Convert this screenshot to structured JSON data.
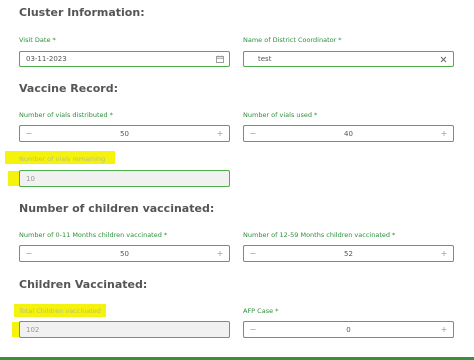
{
  "sections": {
    "cluster_info": "Cluster Information:",
    "vaccine_record": "Vaccine Record:",
    "children_vaccinated_count": "Number of children vaccinated:",
    "children_vaccinated": "Children Vaccinated:"
  },
  "fields": {
    "visit_date": {
      "label": "Visit Date",
      "value": "03-11-2023"
    },
    "district_coordinator": {
      "label": "Name of District Coordinator",
      "value": "test"
    },
    "vials_distributed": {
      "label": "Number of vials distributed",
      "value": "50",
      "minus": "−",
      "plus": "+"
    },
    "vials_used": {
      "label": "Number of vials used",
      "value": "40",
      "minus": "−",
      "plus": "+"
    },
    "vials_remaining": {
      "label": "Number of vials remaining",
      "value": "10"
    },
    "children_0_11": {
      "label": "Number of 0-11 Months children vaccinated",
      "value": "50",
      "minus": "−",
      "plus": "+"
    },
    "children_12_59": {
      "label": "Number of 12-59 Months children vaccinated",
      "value": "52",
      "minus": "−",
      "plus": "+"
    },
    "total_children": {
      "label": "Total Children vaccinated",
      "value": "102"
    },
    "afp_case": {
      "label": "AFP Case",
      "value": "0",
      "minus": "−",
      "plus": "+"
    }
  },
  "required_marker": "*",
  "icons": {
    "calendar": "calendar-icon",
    "clear": "close-icon"
  },
  "colors": {
    "accent": "#2a8f3a",
    "border": "#4cae4c",
    "highlight": "#f4f200"
  }
}
